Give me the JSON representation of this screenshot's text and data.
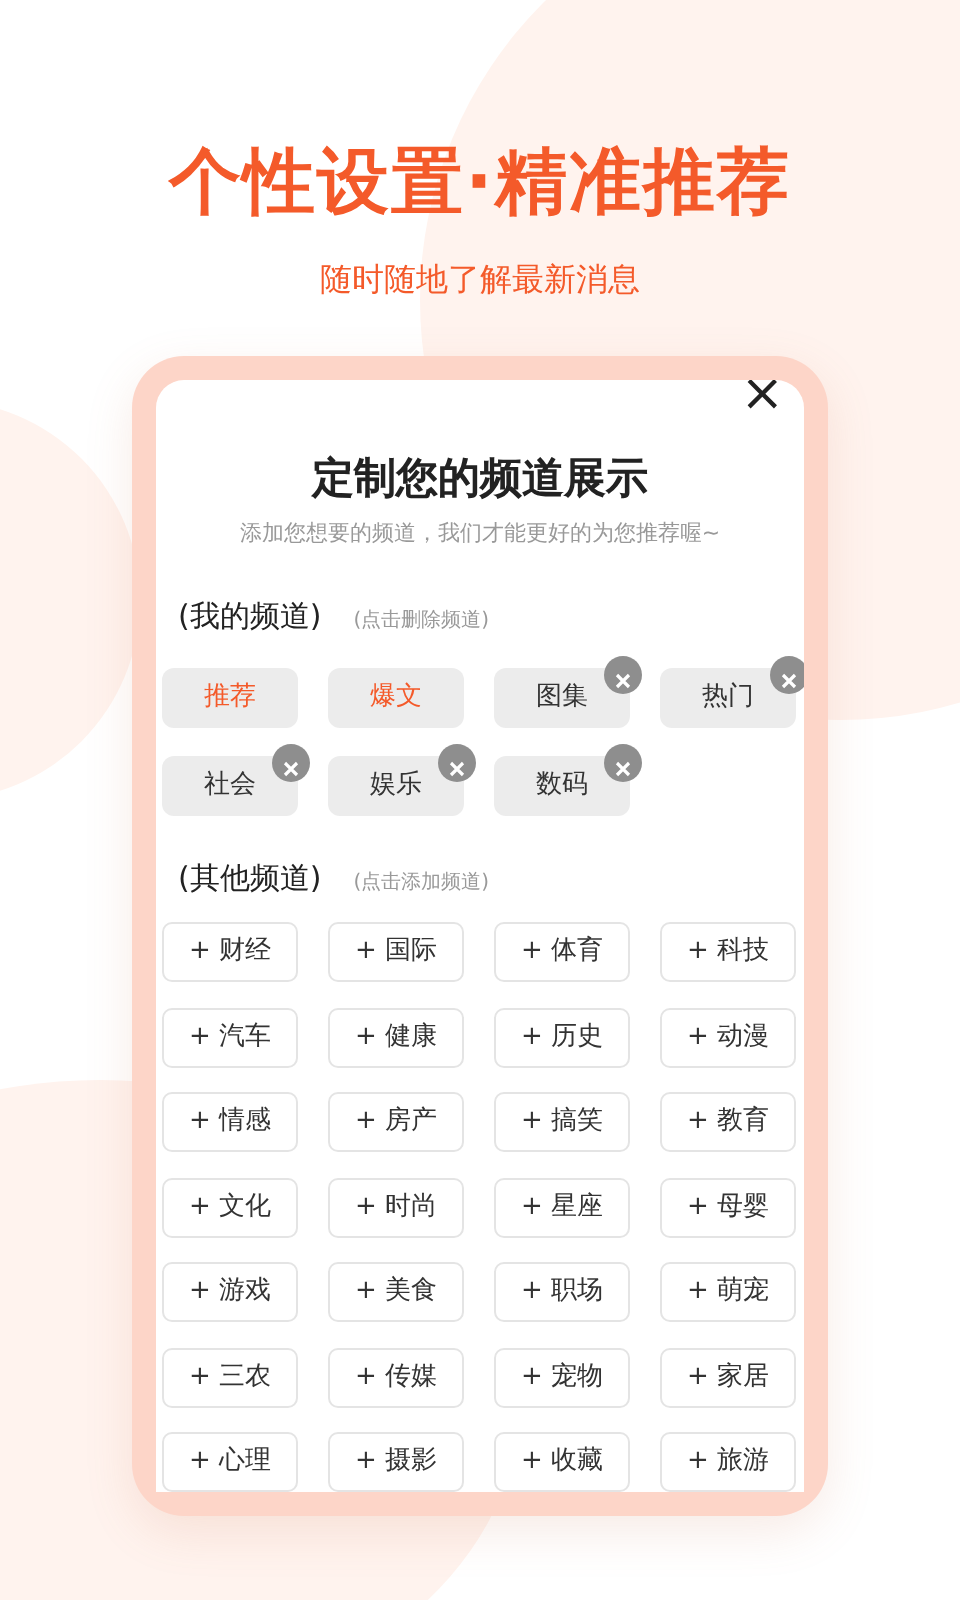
{
  "headline": "个性设置·精准推荐",
  "subheadline": "随时随地了解最新消息",
  "dialog": {
    "close": "×",
    "title": "定制您的频道展示",
    "subtitle": "添加您想要的频道，我们才能更好的为您推荐喔~",
    "my_channels": {
      "label": "(我的频道)",
      "hint": "(点击删除频道)",
      "items": [
        {
          "label": "推荐",
          "kind": "fixed"
        },
        {
          "label": "爆文",
          "kind": "fixed"
        },
        {
          "label": "图集",
          "kind": "removable"
        },
        {
          "label": "热门",
          "kind": "removable"
        },
        {
          "label": "社会",
          "kind": "removable"
        },
        {
          "label": "娱乐",
          "kind": "removable"
        },
        {
          "label": "数码",
          "kind": "removable"
        }
      ]
    },
    "other_channels": {
      "label": "(其他频道)",
      "hint": "(点击添加频道)",
      "items": [
        "+ 财经",
        "+ 国际",
        "+ 体育",
        "+ 科技",
        "+ 汽车",
        "+ 健康",
        "+ 历史",
        "+ 动漫",
        "+ 情感",
        "+ 房产",
        "+ 搞笑",
        "+ 教育",
        "+ 文化",
        "+ 时尚",
        "+ 星座",
        "+ 母婴",
        "+ 游戏",
        "+ 美食",
        "+ 职场",
        "+ 萌宠",
        "+ 三农",
        "+ 传媒",
        "+ 宠物",
        "+ 家居",
        "+ 心理",
        "+ 摄影",
        "+ 收藏",
        "+ 旅游"
      ]
    }
  }
}
